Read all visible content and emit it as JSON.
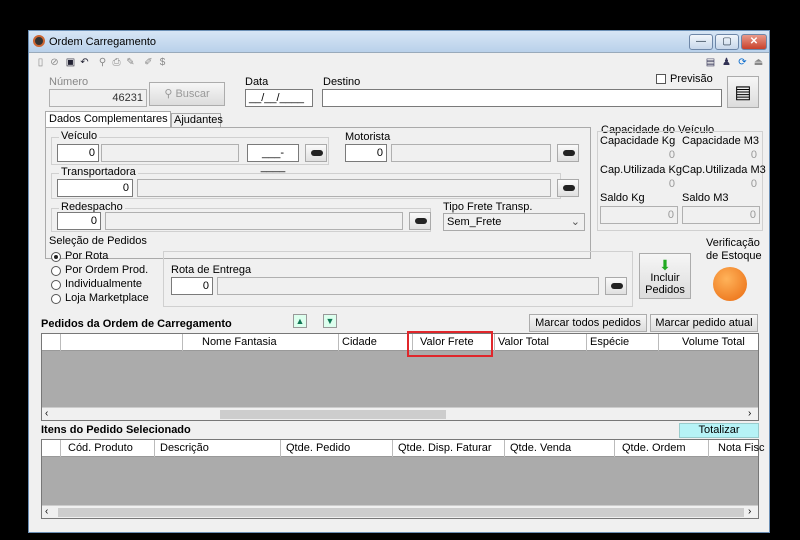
{
  "window": {
    "title": "Ordem Carregamento",
    "min": "—",
    "max": "▢",
    "close": "✕"
  },
  "header": {
    "numero_label": "Número",
    "numero_value": "46231",
    "buscar_label": "Buscar",
    "data_label": "Data",
    "data_value": "__/__/____",
    "destino_label": "Destino",
    "destino_value": "",
    "previsao_label": "Previsão"
  },
  "tabs": {
    "dados": "Dados Complementares",
    "ajudantes": "Ajudantes"
  },
  "veiculo": {
    "label": "Veículo",
    "value": "0",
    "plate": "___-____"
  },
  "motorista": {
    "label": "Motorista",
    "value": "0"
  },
  "transportadora": {
    "label": "Transportadora",
    "value": "0"
  },
  "redespacho": {
    "label": "Redespacho",
    "value": "0"
  },
  "tipo_frete": {
    "label": "Tipo Frete Transp.",
    "value": "Sem_Frete"
  },
  "capacidade": {
    "title": "Capacidade do Veículo",
    "cap_kg_label": "Capacidade Kg",
    "cap_kg": "0",
    "cap_m3_label": "Capacidade M3",
    "cap_m3": "0",
    "util_kg_label": "Cap.Utilizada Kg",
    "util_kg": "0",
    "util_m3_label": "Cap.Utilizada M3",
    "util_m3": "0",
    "saldo_kg_label": "Saldo Kg",
    "saldo_kg": "0",
    "saldo_m3_label": "Saldo M3",
    "saldo_m3": "0"
  },
  "selecao": {
    "title": "Seleção de Pedidos",
    "options": [
      "Por Rota",
      "Por Ordem Prod.",
      "Individualmente",
      "Loja Marketplace"
    ],
    "selected": 0
  },
  "rota": {
    "label": "Rota de Entrega",
    "value": "0"
  },
  "incluir": {
    "line1": "Incluir",
    "line2": "Pedidos"
  },
  "verificacao": {
    "line1": "Verificação",
    "line2": "de Estoque"
  },
  "pedidos": {
    "title": "Pedidos da Ordem de Carregamento",
    "marcar_todos": "Marcar todos pedidos",
    "marcar_atual": "Marcar pedido atual",
    "columns": [
      "Nome Fantasia",
      "Cidade",
      "Valor Frete",
      "Valor Total",
      "Espécie",
      "Volume Total"
    ]
  },
  "itens": {
    "title": "Itens do Pedido Selecionado",
    "totalizar": "Totalizar",
    "columns": [
      "Cód. Produto",
      "Descrição",
      "Qtde. Pedido",
      "Qtde. Disp. Faturar",
      "Qtde. Venda",
      "Qtde. Ordem",
      "Nota Fisc"
    ]
  },
  "colors": {
    "highlight": "#e0262b",
    "totalizar_bg": "#b6f3f6"
  }
}
